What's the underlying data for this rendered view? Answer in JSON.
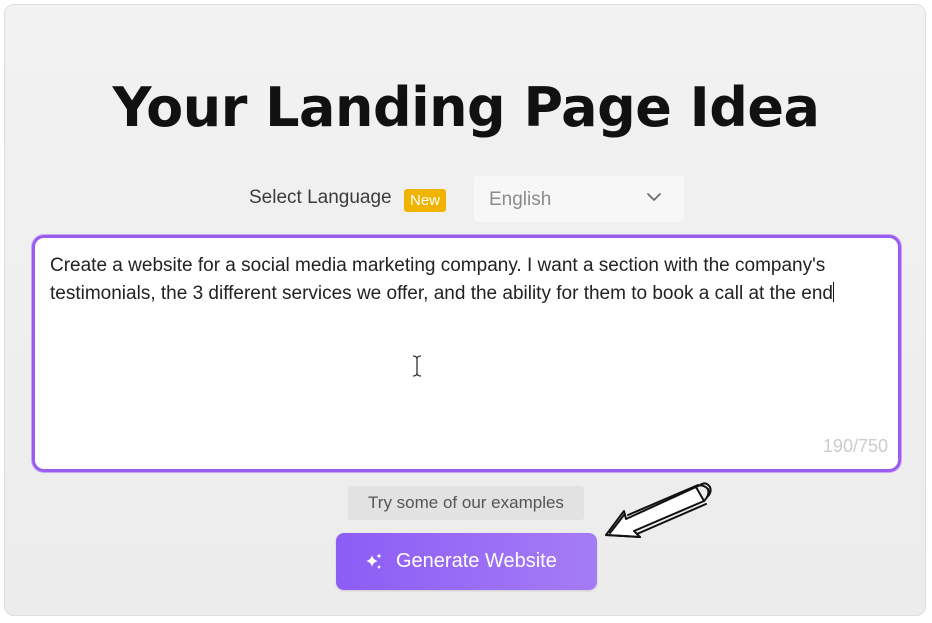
{
  "page": {
    "title": "Your Landing Page Idea"
  },
  "language": {
    "label": "Select Language",
    "badge": "New",
    "selected": "English"
  },
  "prompt": {
    "text": "Create a website for a social media marketing company. I want a section with the company's testimonials, the 3 different services we offer, and the ability for them to book a call at the end",
    "char_count": "190/750"
  },
  "actions": {
    "examples_label": "Try some of our examples",
    "generate_label": "Generate Website"
  },
  "icons": {
    "dropdown": "chevron-down-icon",
    "generate": "sparkle-icon",
    "annotation": "hand-drawn-arrow"
  },
  "colors": {
    "accent": "#9a5cf0",
    "badge": "#f0b400",
    "button_start": "#8d5cf5",
    "button_end": "#a57cf6"
  }
}
